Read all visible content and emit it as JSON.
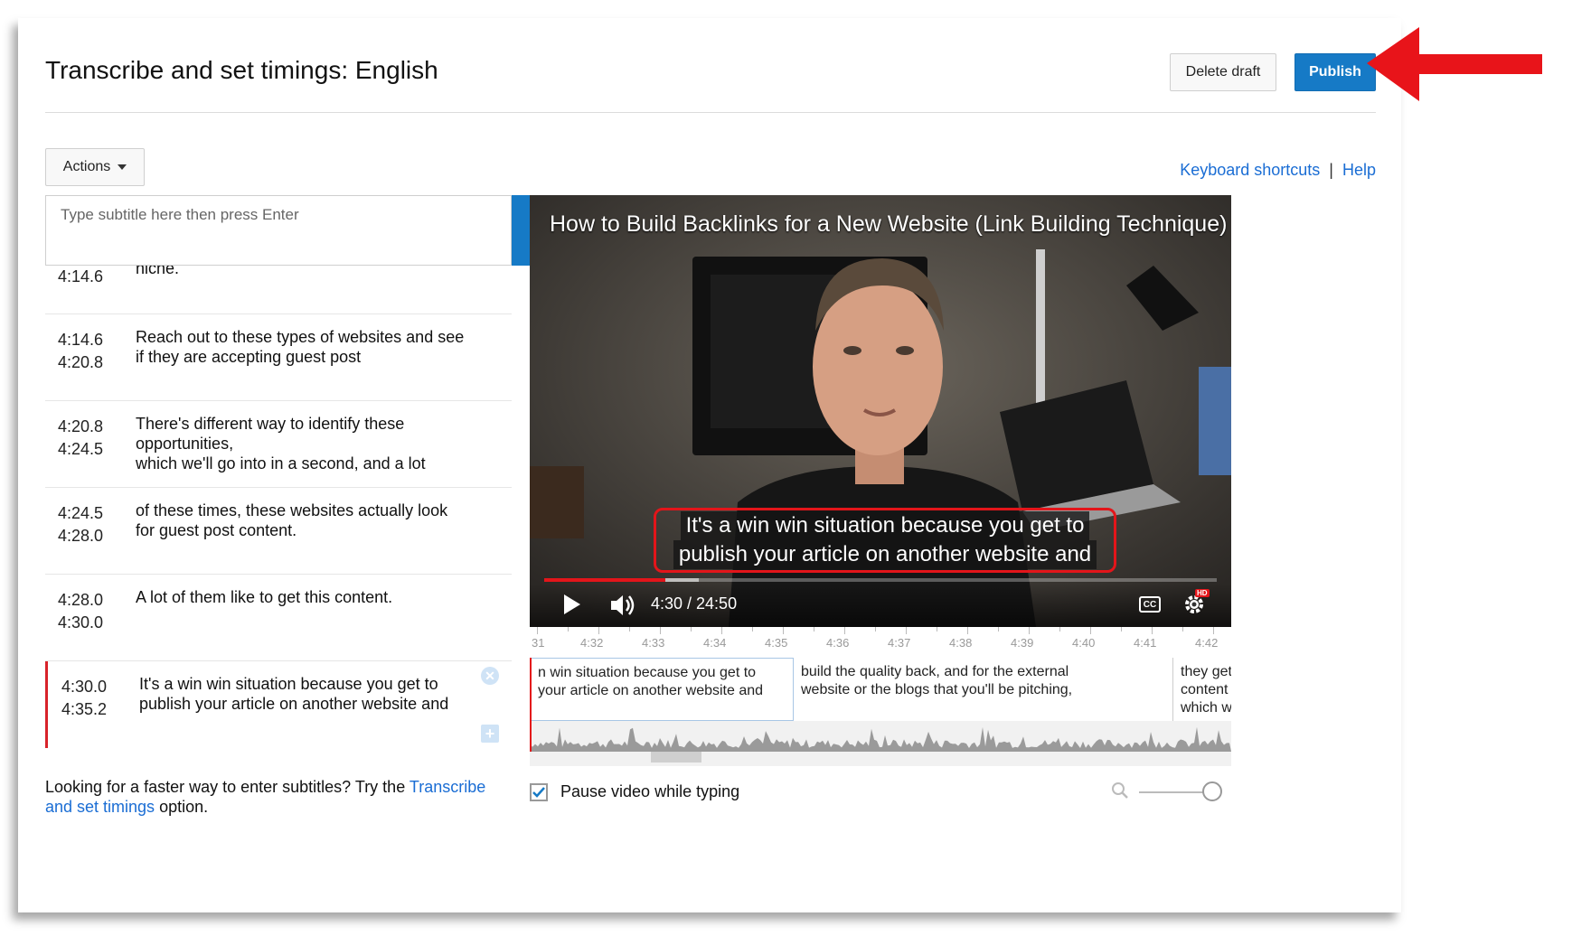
{
  "header": {
    "title": "Transcribe and set timings: English",
    "delete_label": "Delete draft",
    "publish_label": "Publish"
  },
  "toolbar": {
    "actions_label": "Actions",
    "keyboard_shortcuts": "Keyboard shortcuts",
    "help": "Help"
  },
  "input": {
    "placeholder": "Type subtitle here then press Enter",
    "add_symbol": "+"
  },
  "subtitles": [
    {
      "start": "4:14.6",
      "end": "",
      "text": "niche."
    },
    {
      "start": "4:14.6",
      "end": "4:20.8",
      "text": "Reach out to these types of websites and see\nif they are accepting guest post"
    },
    {
      "start": "4:20.8",
      "end": "4:24.5",
      "text": "There's different way to identify these opportunities,\nwhich we'll go into in a second, and a lot"
    },
    {
      "start": "4:24.5",
      "end": "4:28.0",
      "text": "of these times, these websites actually look\nfor guest post content."
    },
    {
      "start": "4:28.0",
      "end": "4:30.0",
      "text": "A lot of them like to get this content."
    },
    {
      "start": "4:30.0",
      "end": "4:35.2",
      "text": "It's a win win situation because you get to\npublish your article on another website and",
      "active": true
    }
  ],
  "footer_note": {
    "prefix": "Looking for a faster way to enter subtitles? Try the ",
    "link": "Transcribe and set timings",
    "suffix": " option."
  },
  "video": {
    "title": "How to Build Backlinks for a New Website (Link Building Technique)",
    "caption_line1": "It's a win win situation because you get to",
    "caption_line2": "publish your article on another website and",
    "timecode": "4:30 / 24:50",
    "cc_label": "CC",
    "hd_label": "HD",
    "progress": 0.18,
    "buffered": 0.23
  },
  "timeline": {
    "ticks": [
      "31",
      "4:32",
      "4:33",
      "4:34",
      "4:35",
      "4:36",
      "4:37",
      "4:38",
      "4:39",
      "4:40",
      "4:41",
      "4:42"
    ],
    "segments": [
      {
        "line1": "n win situation because you get to",
        "line2": "your article on another website and",
        "line3": "",
        "active": true
      },
      {
        "line1": "build the quality back, and for the external",
        "line2": "website or the blogs that you'll be pitching,",
        "line3": ""
      },
      {
        "line1": "they get",
        "line2": "content",
        "line3": "which w"
      }
    ]
  },
  "options": {
    "pause_label": "Pause video while typing",
    "pause_checked": true
  },
  "colors": {
    "accent": "#167ac6",
    "link": "#1a6dd4",
    "highlight_red": "#e3151a"
  }
}
